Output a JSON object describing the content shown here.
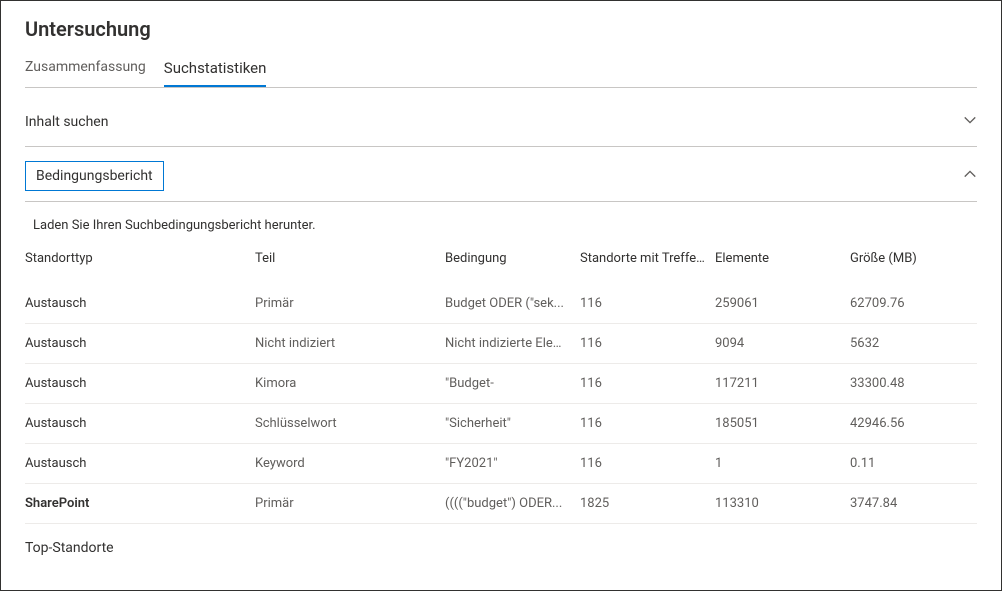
{
  "title": "Untersuchung",
  "tabs": {
    "summary": "Zusammenfassung",
    "stats": "Suchstatistiken"
  },
  "sections": {
    "search_content": "Inhalt suchen",
    "condition_report": "Bedingungsbericht",
    "top_locations": "Top-Standorte"
  },
  "description": "Laden Sie Ihren Suchbedingungsbericht herunter.",
  "columns": {
    "location_type": "Standorttyp",
    "part": "Teil",
    "condition": "Bedingung",
    "locations_hits": "Standorte mit Treffern",
    "items": "Elemente",
    "size": "Größe (MB)"
  },
  "rows": [
    {
      "location_type": "Austausch",
      "part": "Primär",
      "condition": "Budget ODER (\"sek...",
      "locations_hits": "116",
      "items": "259061",
      "size": "62709.76",
      "bold": false
    },
    {
      "location_type": "Austausch",
      "part": "Nicht indiziert",
      "condition": "Nicht indizierte Elemente",
      "locations_hits": "116",
      "items": "9094",
      "size": "5632",
      "bold": false
    },
    {
      "location_type": "Austausch",
      "part": "Kimora",
      "condition": "\"Budget-",
      "locations_hits": "116",
      "items": "117211",
      "size": "33300.48",
      "bold": false
    },
    {
      "location_type": "Austausch",
      "part": "Schlüsselwort",
      "condition": "\"Sicherheit\"",
      "locations_hits": "116",
      "items": "185051",
      "size": "42946.56",
      "bold": false
    },
    {
      "location_type": "Austausch",
      "part": "Keyword",
      "condition": "\"FY2021\"",
      "locations_hits": "116",
      "items": "1",
      "size": "0.11",
      "bold": false
    },
    {
      "location_type": "SharePoint",
      "part": "Primär",
      "condition": "((((\"budget\") ODER...",
      "locations_hits": "1825",
      "items": "113310",
      "size": "3747.84",
      "bold": true
    }
  ]
}
